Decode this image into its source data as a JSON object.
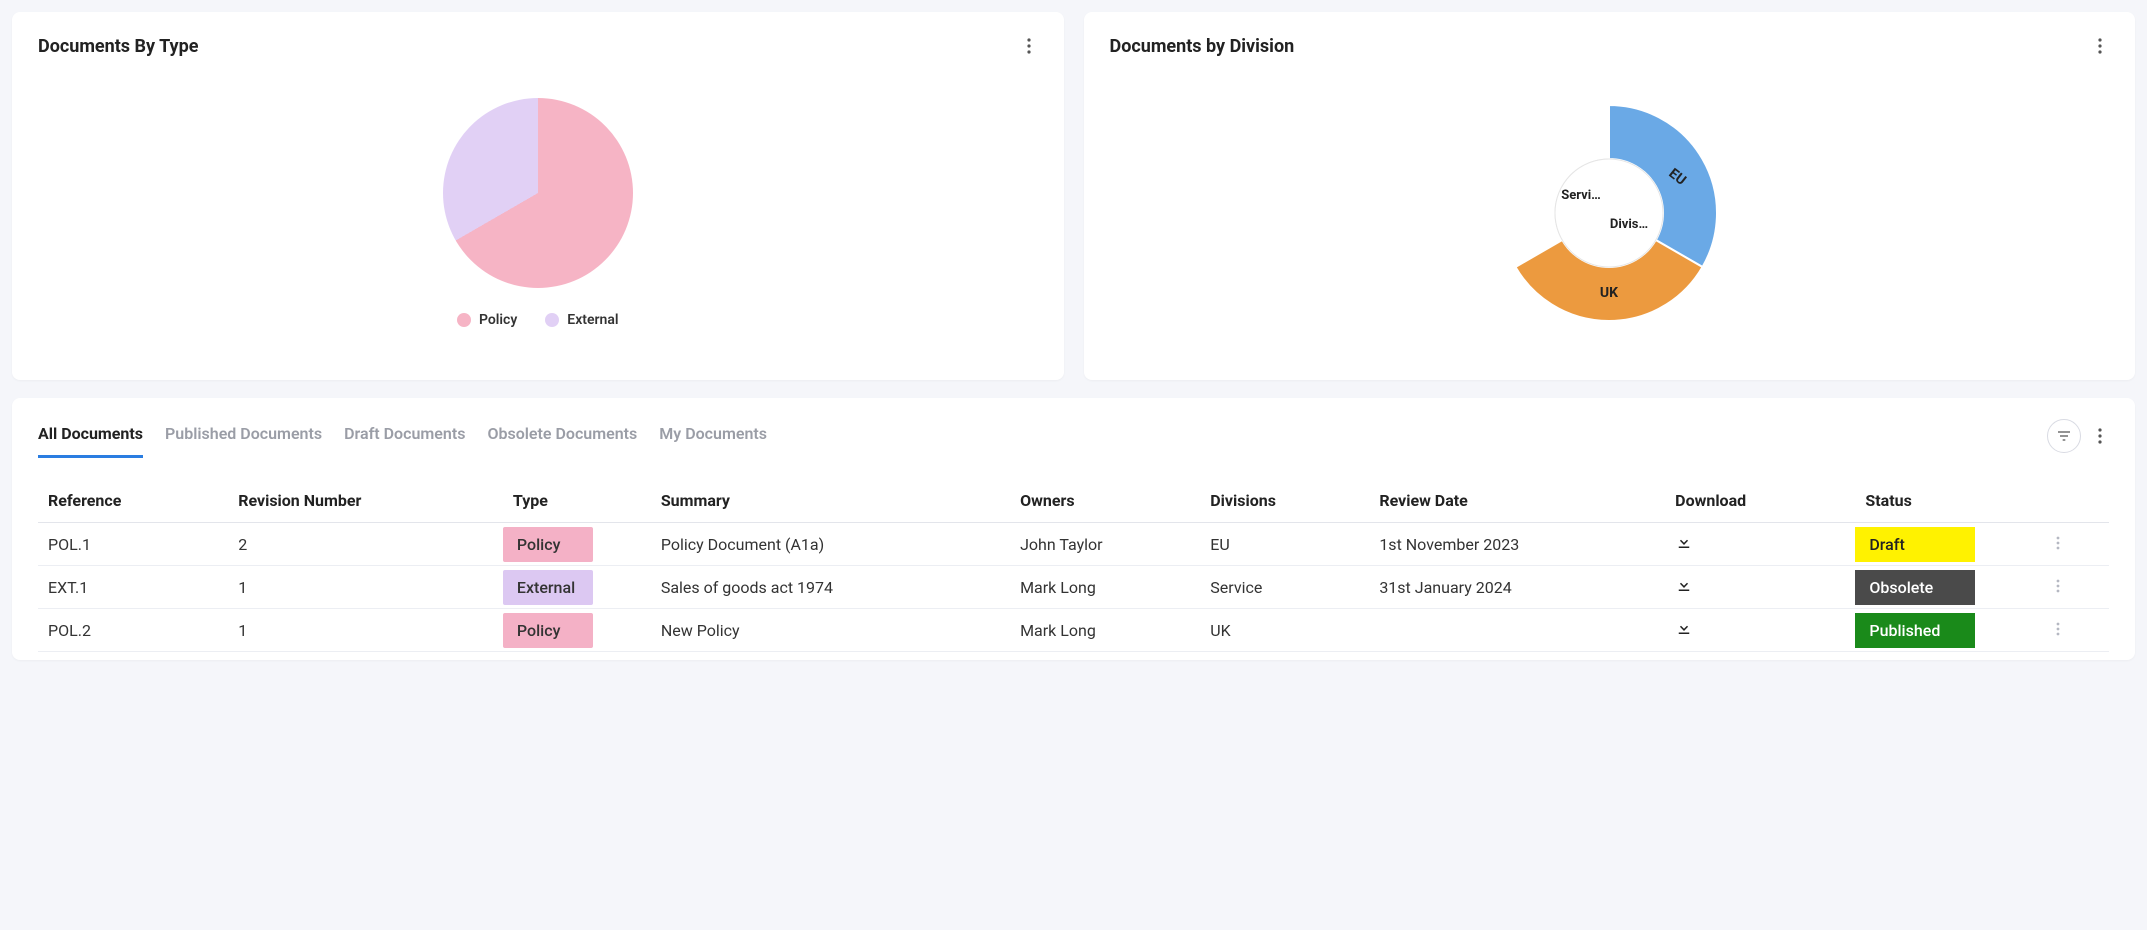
{
  "cards": {
    "byType": {
      "title": "Documents By Type",
      "legend": [
        {
          "label": "Policy",
          "color": "#f6b4c5"
        },
        {
          "label": "External",
          "color": "#e1d0f5"
        }
      ]
    },
    "byDivision": {
      "title": "Documents by Division",
      "labels": {
        "eu": "EU",
        "uk": "UK",
        "servi": "Servi…",
        "divis": "Divis…"
      }
    }
  },
  "tabs": {
    "items": [
      {
        "label": "All Documents",
        "active": true
      },
      {
        "label": "Published Documents",
        "active": false
      },
      {
        "label": "Draft Documents",
        "active": false
      },
      {
        "label": "Obsolete Documents",
        "active": false
      },
      {
        "label": "My Documents",
        "active": false
      }
    ]
  },
  "table": {
    "headers": {
      "reference": "Reference",
      "revision": "Revision Number",
      "type": "Type",
      "summary": "Summary",
      "owners": "Owners",
      "divisions": "Divisions",
      "review": "Review Date",
      "download": "Download",
      "status": "Status"
    },
    "rows": [
      {
        "reference": "POL.1",
        "revision": "2",
        "type": "Policy",
        "typeBg": "#f4b1c6",
        "typeColor": "#333",
        "summary": "Policy Document (A1a)",
        "owners": "John Taylor",
        "divisions": "EU",
        "review": "1st November 2023",
        "status": "Draft",
        "statusBg": "#fff200",
        "statusColor": "#222"
      },
      {
        "reference": "EXT.1",
        "revision": "1",
        "type": "External",
        "typeBg": "#dcc8f2",
        "typeColor": "#333",
        "summary": "Sales of goods act 1974",
        "owners": "Mark Long",
        "divisions": "Service",
        "review": "31st January 2024",
        "status": "Obsolete",
        "statusBg": "#4a4a4a",
        "statusColor": "#fff"
      },
      {
        "reference": "POL.2",
        "revision": "1",
        "type": "Policy",
        "typeBg": "#f4b1c6",
        "typeColor": "#333",
        "summary": "New Policy",
        "owners": "Mark Long",
        "divisions": "UK",
        "review": "",
        "status": "Published",
        "statusBg": "#1a8a1a",
        "statusColor": "#fff"
      }
    ]
  },
  "chart_data": [
    {
      "type": "pie",
      "title": "Documents By Type",
      "series": [
        {
          "name": "Policy",
          "value": 67,
          "color": "#f6b4c5"
        },
        {
          "name": "External",
          "value": 33,
          "color": "#e1d0f5"
        }
      ]
    },
    {
      "type": "pie",
      "title": "Documents by Division",
      "inner_labels": [
        "Servi…",
        "Divis…"
      ],
      "series": [
        {
          "name": "EU",
          "value": 33,
          "color": "#6aa9e6"
        },
        {
          "name": "UK",
          "value": 33,
          "color": "#ec9a3f"
        },
        {
          "name": "(blank)",
          "value": 33,
          "color": "#ffffff"
        }
      ]
    }
  ]
}
